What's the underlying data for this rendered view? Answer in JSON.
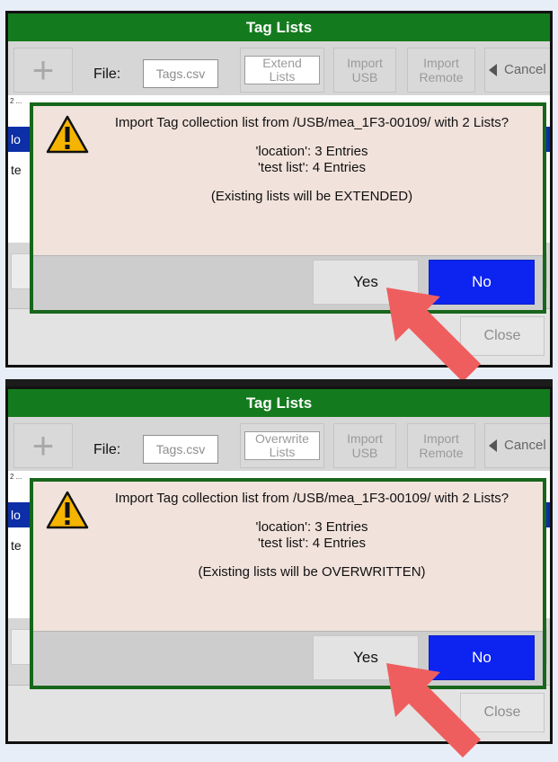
{
  "colors": {
    "title_bar": "#147a1e",
    "dialog_border": "#17661b",
    "dialog_bg": "#f1e2db",
    "no_button": "#0d24f0",
    "selection": "#0c2ea6",
    "arrow": "#ef5e5e"
  },
  "panels": [
    {
      "title": "Tag Lists",
      "toolbar": {
        "add_icon": "plus-icon",
        "file_label": "File:",
        "file_value": "Tags.csv",
        "mode_line1": "Extend",
        "mode_line2": "Lists",
        "import_usb_line1": "Import",
        "import_usb_line2": "USB",
        "import_remote_line1": "Import",
        "import_remote_line2": "Remote",
        "cancel_label": "Cancel",
        "cancel_icon": "triangle-left-icon"
      },
      "list": {
        "count": "2 ...",
        "item1": "lo",
        "item2": "te"
      },
      "dialog": {
        "icon": "warning-icon",
        "line1": "Import Tag collection list from /USB/mea_1F3-00109/ with 2 Lists?",
        "line2": "'location': 3 Entries",
        "line3": "'test list': 4 Entries",
        "line4": "(Existing lists will be EXTENDED)",
        "yes_label": "Yes",
        "no_label": "No"
      },
      "close_label": "Close"
    },
    {
      "title": "Tag Lists",
      "toolbar": {
        "add_icon": "plus-icon",
        "file_label": "File:",
        "file_value": "Tags.csv",
        "mode_line1": "Overwrite",
        "mode_line2": "Lists",
        "import_usb_line1": "Import",
        "import_usb_line2": "USB",
        "import_remote_line1": "Import",
        "import_remote_line2": "Remote",
        "cancel_label": "Cancel",
        "cancel_icon": "triangle-left-icon"
      },
      "list": {
        "count": "2 ...",
        "item1": "lo",
        "item2": "te"
      },
      "dialog": {
        "icon": "warning-icon",
        "line1": "Import Tag collection list from /USB/mea_1F3-00109/ with 2 Lists?",
        "line2": "'location': 3 Entries",
        "line3": "'test list': 4 Entries",
        "line4": "(Existing lists will be OVERWRITTEN)",
        "yes_label": "Yes",
        "no_label": "No"
      },
      "close_label": "Close"
    }
  ]
}
